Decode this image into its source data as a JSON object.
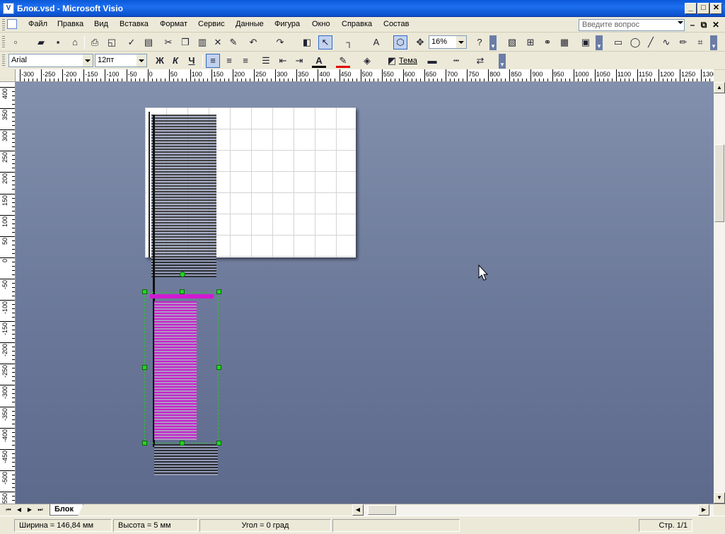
{
  "window": {
    "title": "Блок.vsd - Microsoft Visio",
    "app_icon": "visio-app-icon"
  },
  "window_controls": {
    "minimize": "_",
    "maximize": "□",
    "close": "✕"
  },
  "menu": {
    "items": [
      "Файл",
      "Правка",
      "Вид",
      "Вставка",
      "Формат",
      "Сервис",
      "Данные",
      "Фигура",
      "Окно",
      "Справка",
      "Состав"
    ]
  },
  "help": {
    "placeholder": "Введите вопрос"
  },
  "doc_controls": {
    "minimize": "–",
    "restore": "⧉",
    "close": "✕"
  },
  "standard_toolbar": {
    "zoom": "16%"
  },
  "format_toolbar": {
    "font": "Arial",
    "size": "12пт",
    "bold": "Ж",
    "italic": "К",
    "underline": "Ч",
    "font_color_letter": "A",
    "theme_label": "Тема"
  },
  "rulers": {
    "h_ticks": [
      "-300",
      "-250",
      "-200",
      "-150",
      "-100",
      "-50",
      "0",
      "50",
      "100",
      "150",
      "200",
      "250",
      "300",
      "350",
      "400",
      "450",
      "500",
      "550",
      "600",
      "650",
      "700",
      "750",
      "800",
      "850",
      "900",
      "950",
      "1000",
      "1050",
      "1100",
      "1150",
      "1200",
      "1250",
      "1300"
    ],
    "v_ticks": [
      "400",
      "350",
      "300",
      "250",
      "200",
      "150",
      "100",
      "50",
      "0",
      "-50",
      "-100",
      "-150",
      "-200",
      "-250",
      "-300",
      "-350",
      "-400",
      "-450",
      "-500",
      "-550"
    ]
  },
  "page_tabs": {
    "active": "Блок"
  },
  "status": {
    "width": "Ширина = 146,84 мм",
    "height": "Высота = 5 мм",
    "angle": "Угол = 0 град",
    "page": "Стр. 1/1"
  },
  "colors": {
    "title_bar": "#0a58d8",
    "canvas": "#6b7899",
    "selection_handle": "#24d424",
    "magenta_shape": "#d01ad0"
  }
}
